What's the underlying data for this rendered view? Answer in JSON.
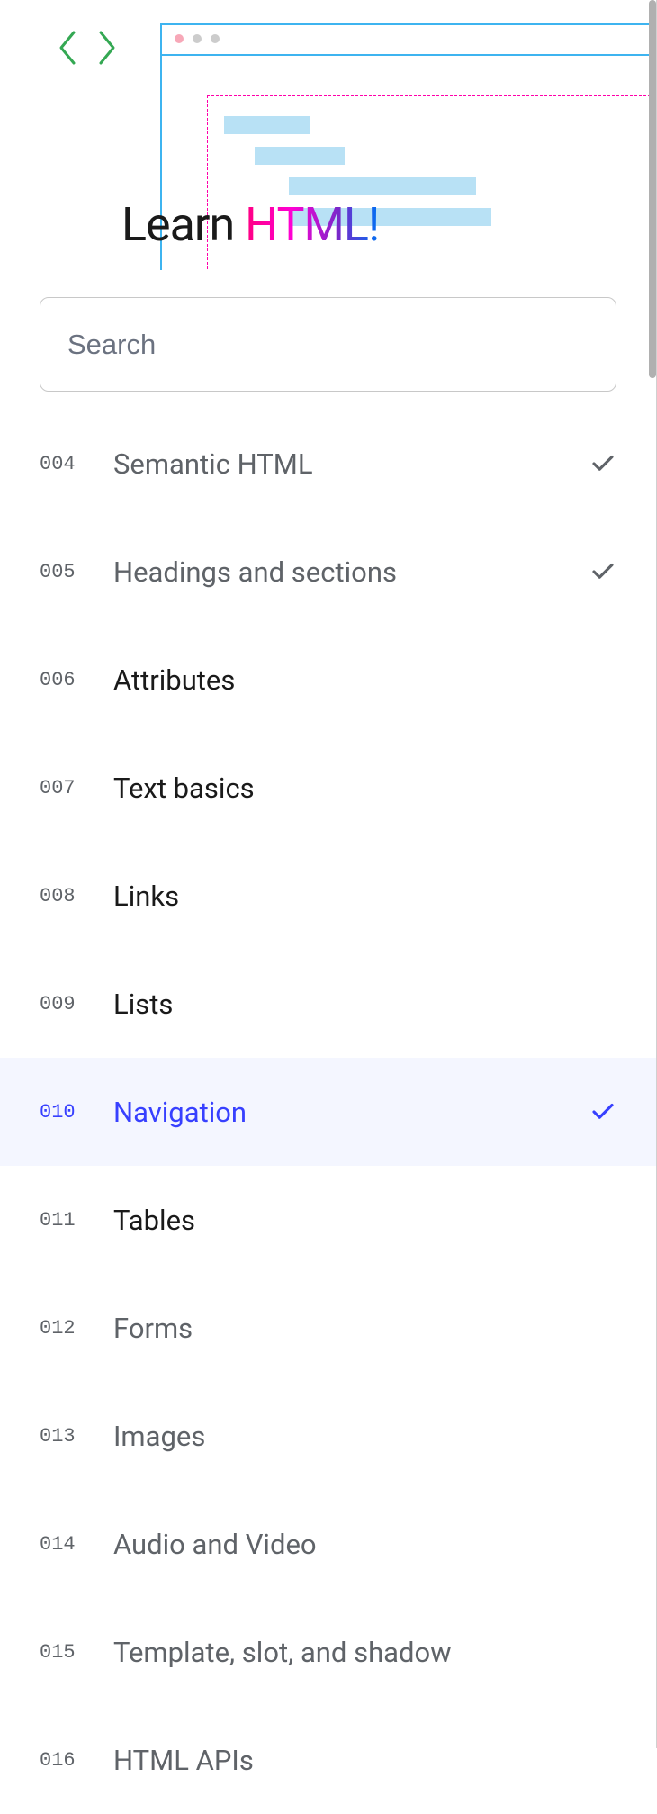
{
  "hero": {
    "title_plain": "Learn ",
    "title_gradient": "HTML!"
  },
  "search": {
    "placeholder": "Search"
  },
  "toc": [
    {
      "num": "004",
      "label": "Semantic HTML",
      "checked": true,
      "muted": true,
      "active": false
    },
    {
      "num": "005",
      "label": "Headings and sections",
      "checked": true,
      "muted": true,
      "active": false
    },
    {
      "num": "006",
      "label": "Attributes",
      "checked": false,
      "muted": false,
      "active": false
    },
    {
      "num": "007",
      "label": "Text basics",
      "checked": false,
      "muted": false,
      "active": false
    },
    {
      "num": "008",
      "label": "Links",
      "checked": false,
      "muted": false,
      "active": false
    },
    {
      "num": "009",
      "label": "Lists",
      "checked": false,
      "muted": false,
      "active": false
    },
    {
      "num": "010",
      "label": "Navigation",
      "checked": true,
      "muted": false,
      "active": true
    },
    {
      "num": "011",
      "label": "Tables",
      "checked": false,
      "muted": false,
      "active": false
    },
    {
      "num": "012",
      "label": "Forms",
      "checked": false,
      "muted": true,
      "active": false
    },
    {
      "num": "013",
      "label": "Images",
      "checked": false,
      "muted": true,
      "active": false
    },
    {
      "num": "014",
      "label": "Audio and Video",
      "checked": false,
      "muted": true,
      "active": false
    },
    {
      "num": "015",
      "label": "Template, slot, and shadow",
      "checked": false,
      "muted": true,
      "active": false
    },
    {
      "num": "016",
      "label": "HTML APIs",
      "checked": false,
      "muted": true,
      "active": false
    }
  ]
}
